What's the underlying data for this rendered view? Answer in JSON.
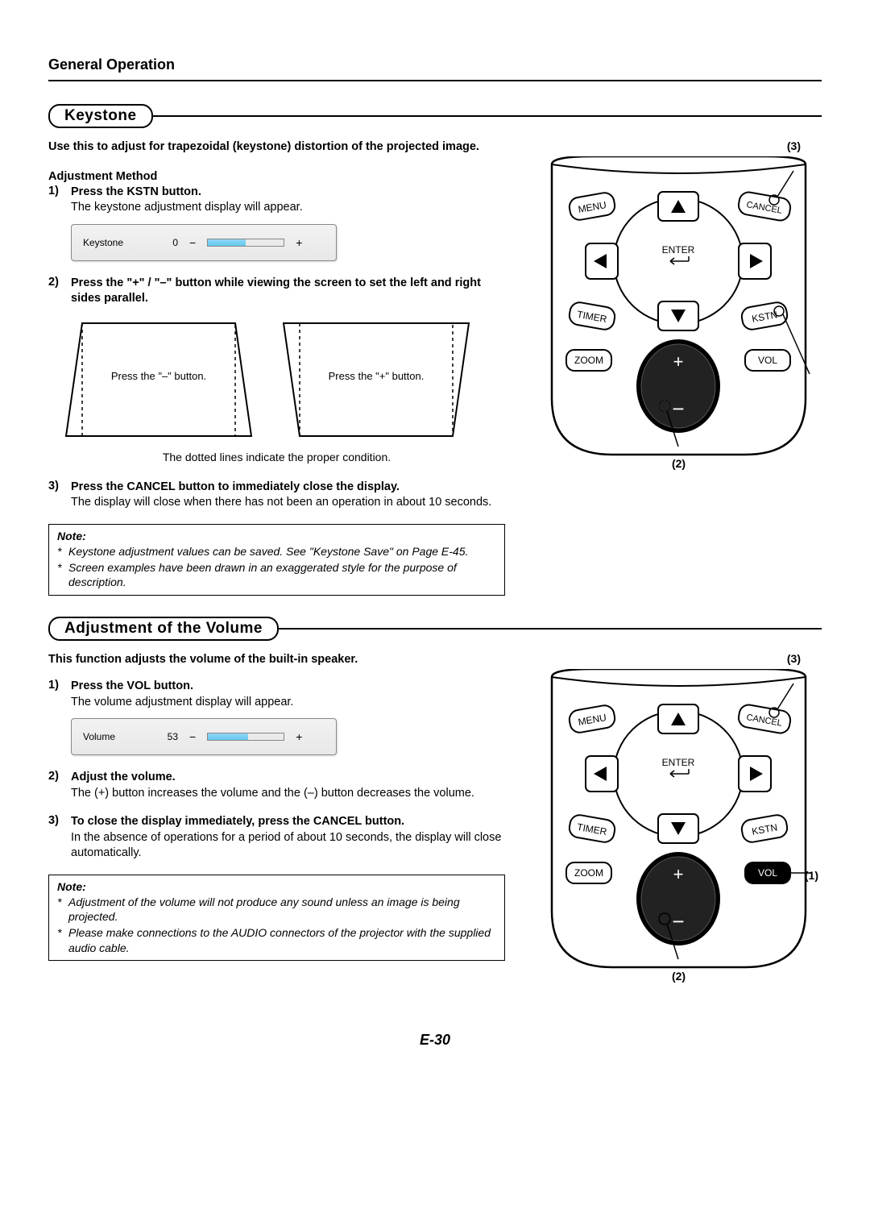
{
  "header": {
    "title": "General Operation"
  },
  "section1": {
    "title": "Keystone",
    "intro": "Use this to adjust for trapezoidal (keystone) distortion of the projected image.",
    "adj_method": "Adjustment Method",
    "step1_num": "1)",
    "step1_title": "Press the KSTN button.",
    "step1_desc": "The keystone adjustment display will appear.",
    "osd": {
      "label": "Keystone",
      "value": "0",
      "minus": "−",
      "plus": "+",
      "fill_pct": 50
    },
    "step2_num": "2)",
    "step2_title": "Press the \"+\" / \"–\" button while viewing the screen to set the left and right sides parallel.",
    "trap_minus_caption": "Press the \"–\" button.",
    "trap_plus_caption": "Press the \"+\" button.",
    "dotted_note": "The dotted lines indicate the proper condition.",
    "step3_num": "3)",
    "step3_title": "Press the CANCEL button to immediately close the display.",
    "step3_desc": "The display will close when there has not been an operation in about 10 seconds.",
    "note_title": "Note:",
    "note1": "Keystone adjustment values can be saved. See \"Keystone Save\" on Page E-45.",
    "note2": "Screen examples have been drawn in an exaggerated style for the purpose of description."
  },
  "section2": {
    "title": "Adjustment of the Volume",
    "intro": "This function adjusts the volume of the built-in speaker.",
    "step1_num": "1)",
    "step1_title": "Press the VOL button.",
    "step1_desc": "The volume adjustment display will appear.",
    "osd": {
      "label": "Volume",
      "value": "53",
      "minus": "−",
      "plus": "+",
      "fill_pct": 53
    },
    "step2_num": "2)",
    "step2_title": "Adjust the volume.",
    "step2_desc": "The (+) button increases the volume and the (–) button decreases the volume.",
    "step3_num": "3)",
    "step3_title": "To close the display immediately, press the CANCEL button.",
    "step3_desc": "In the absence of operations for a period of about 10 seconds, the display will close automatically.",
    "note_title": "Note:",
    "note1": "Adjustment of the volume will not produce any sound unless an image is being projected.",
    "note2": "Please make connections to the AUDIO connectors of the projector with the supplied audio cable."
  },
  "remote": {
    "menu": "MENU",
    "cancel": "CANCEL",
    "enter": "ENTER",
    "timer": "TIMER",
    "kstn": "KSTN",
    "zoom": "ZOOM",
    "vol": "VOL",
    "plus": "+",
    "minus": "−"
  },
  "callouts": {
    "c1": "(1)",
    "c2": "(2)",
    "c3": "(3)"
  },
  "page_number": "E-30"
}
